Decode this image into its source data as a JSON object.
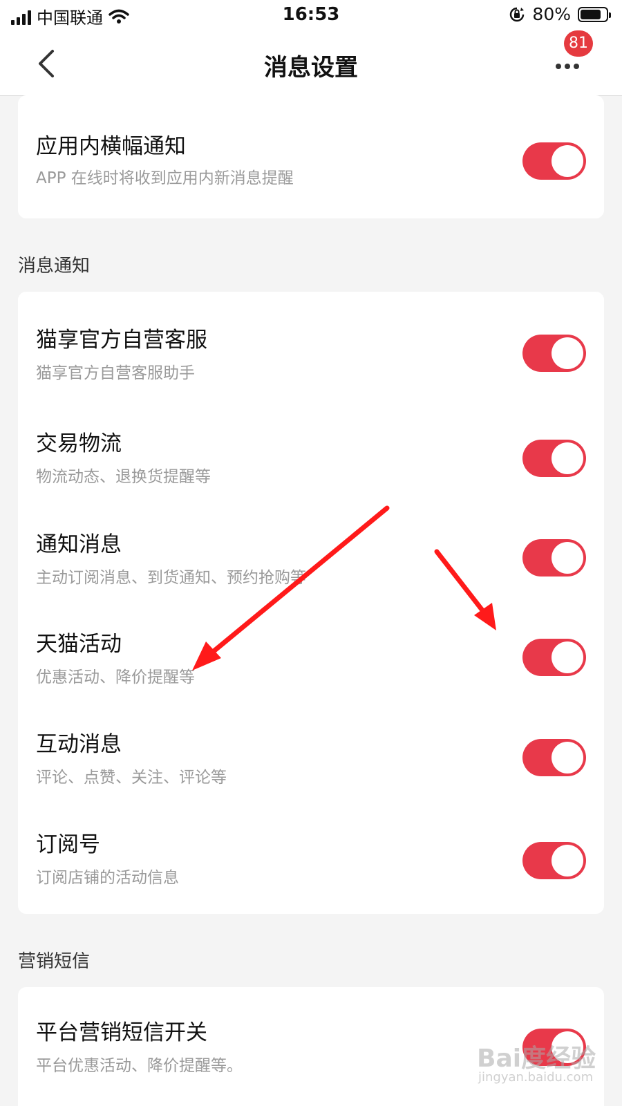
{
  "status_bar": {
    "carrier": "中国联通",
    "time": "16:53",
    "battery": "80%",
    "battery_level": 0.8
  },
  "header": {
    "title": "消息设置",
    "badge": "81",
    "back_icon": "chevron-left-icon",
    "more_icon": "more-dots-icon"
  },
  "top_card": {
    "item": {
      "title": "应用内横幅通知",
      "subtitle": "APP 在线时将收到应用内新消息提醒",
      "enabled": true
    }
  },
  "sections": [
    {
      "title": "消息通知",
      "items": [
        {
          "title": "猫享官方自营客服",
          "subtitle": "猫享官方自营客服助手",
          "enabled": true
        },
        {
          "title": "交易物流",
          "subtitle": "物流动态、退换货提醒等",
          "enabled": true
        },
        {
          "title": "通知消息",
          "subtitle": "主动订阅消息、到货通知、预约抢购等",
          "enabled": true
        },
        {
          "title": "天猫活动",
          "subtitle": "优惠活动、降价提醒等",
          "enabled": true
        },
        {
          "title": "互动消息",
          "subtitle": "评论、点赞、关注、评论等",
          "enabled": true
        },
        {
          "title": "订阅号",
          "subtitle": "订阅店铺的活动信息",
          "enabled": true
        }
      ]
    },
    {
      "title": "营销短信",
      "items": [
        {
          "title": "平台营销短信开关",
          "subtitle": "平台优惠活动、降价提醒等。",
          "enabled": true
        }
      ]
    }
  ],
  "colors": {
    "toggle_on": "#e8394a",
    "badge": "#e53a3f",
    "annotation_arrow": "#ff1a1a"
  },
  "watermark": {
    "brand": "Bai度经验",
    "url": "jingyan.baidu.com"
  }
}
